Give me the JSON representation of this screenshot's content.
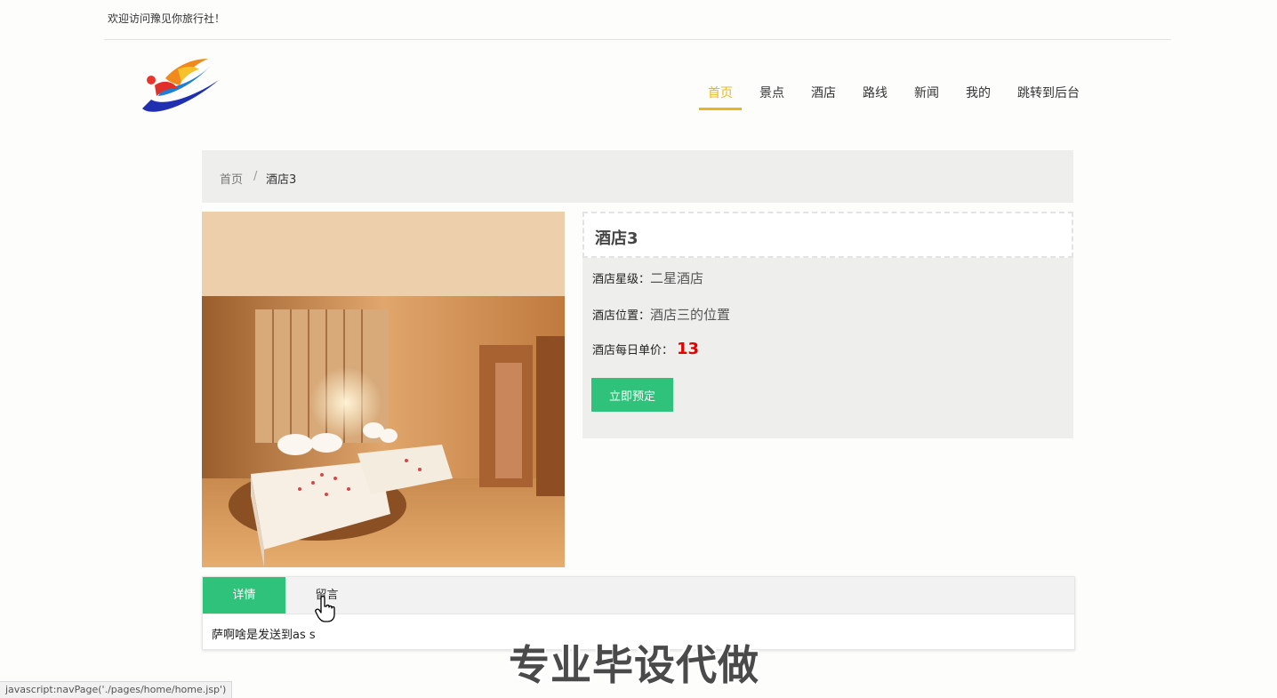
{
  "header": {
    "welcome_text": "欢迎访问豫见你旅行社！",
    "nav": [
      {
        "label": "首页",
        "active": true
      },
      {
        "label": "景点"
      },
      {
        "label": "酒店"
      },
      {
        "label": "路线"
      },
      {
        "label": "新闻"
      },
      {
        "label": "我的"
      },
      {
        "label": "跳转到后台"
      }
    ]
  },
  "breadcrumb": {
    "home": "首页",
    "separator": "/",
    "current": "酒店3"
  },
  "hotel": {
    "name": "酒店3",
    "star_label": "酒店星级：",
    "star_value": "二星酒店",
    "location_label": "酒店位置：",
    "location_value": "酒店三的位置",
    "price_label": "酒店每日单价：",
    "price_value": "13",
    "book_button": "立即预定"
  },
  "tabs": {
    "detail": "详情",
    "message": "留言",
    "content": "萨啊啥是发送到as s"
  },
  "overlay": {
    "watermark": "专业毕设代做",
    "status_url": "javascript:navPage('./pages/home/home.jsp')"
  },
  "colors": {
    "accent_green": "#2fc27a",
    "nav_active": "#e6b820",
    "price_red": "#e60000"
  }
}
